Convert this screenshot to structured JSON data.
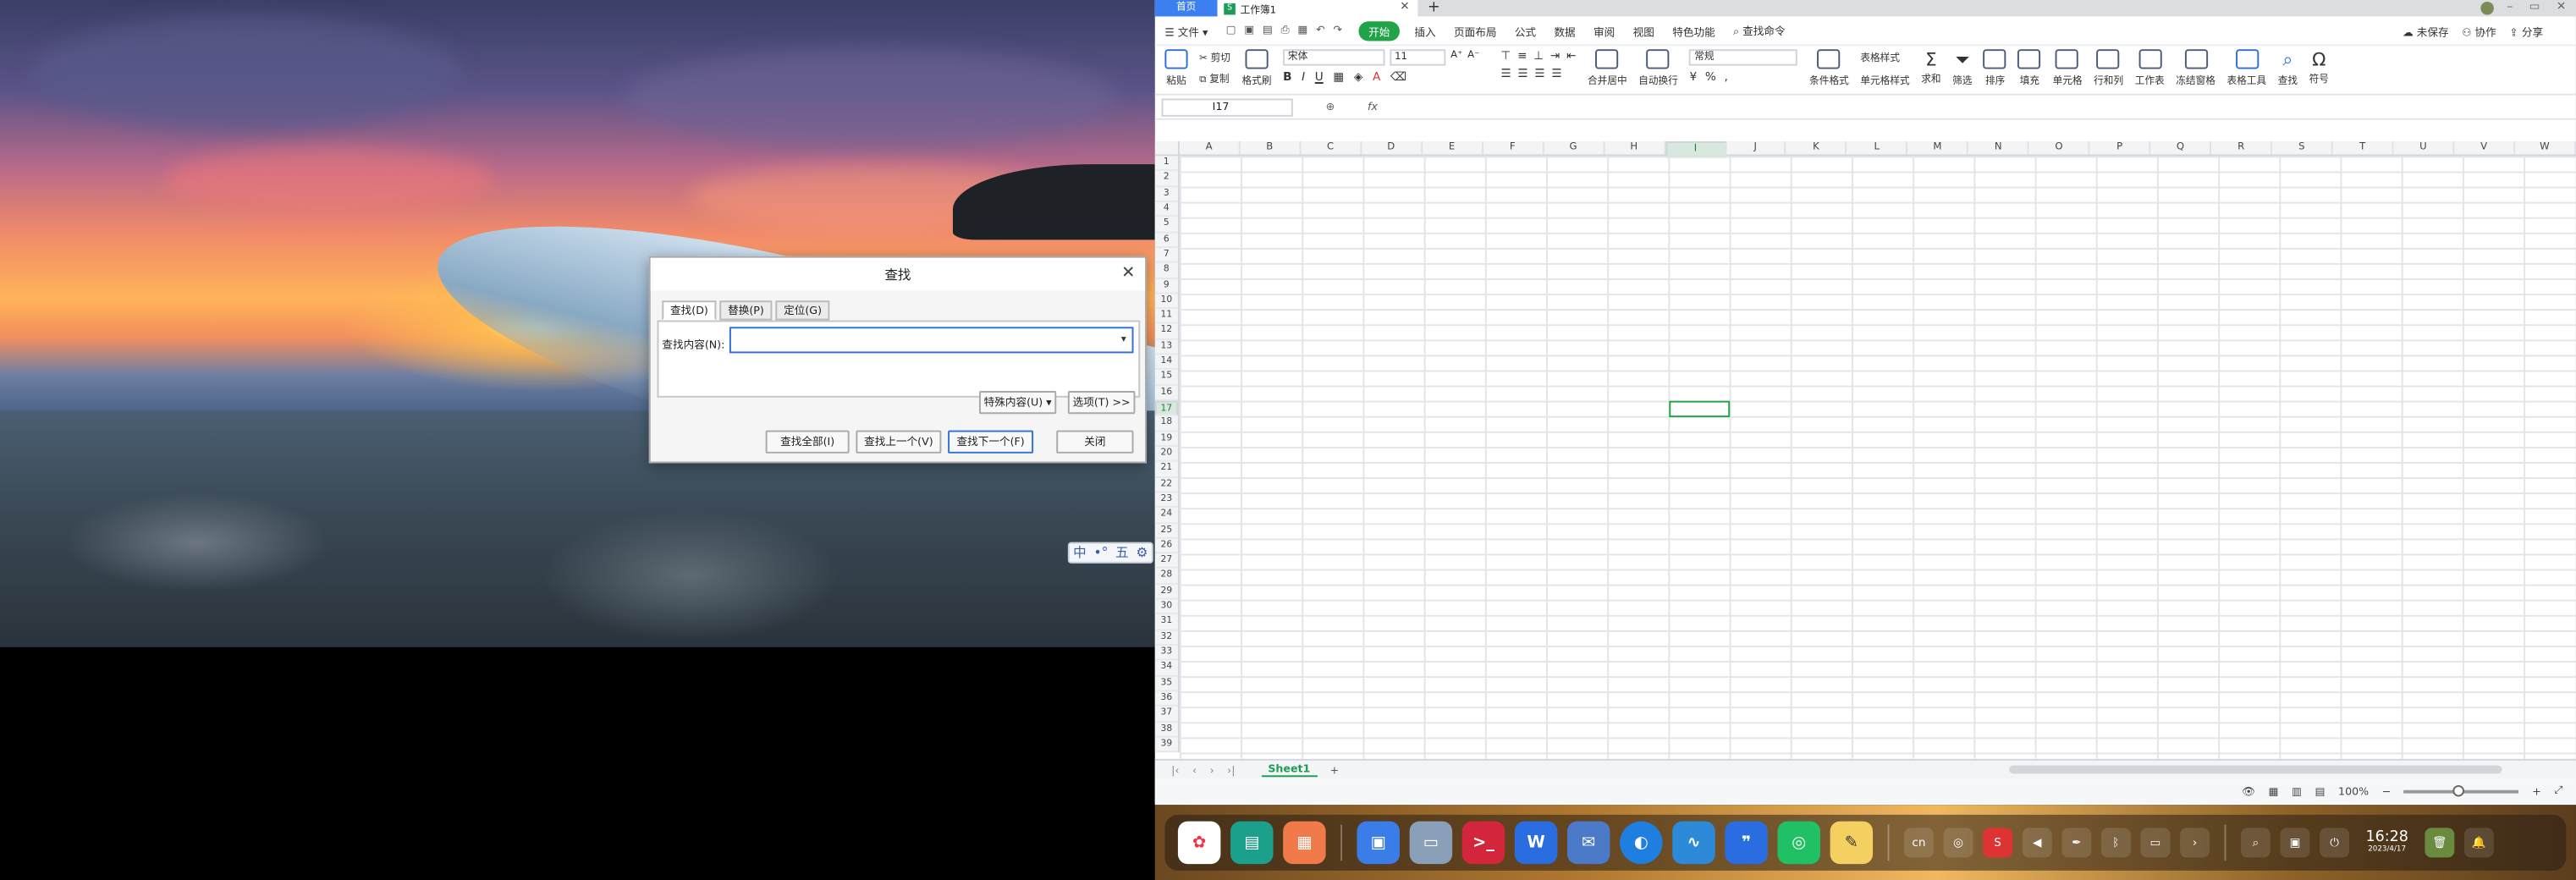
{
  "find_dialog": {
    "title": "查找",
    "tabs": [
      "查找(D)",
      "替换(P)",
      "定位(G)"
    ],
    "find_label": "查找内容(N):",
    "find_value": "",
    "special_button": "特殊内容(U)",
    "options_button": "选项(T) >>",
    "find_all": "查找全部(I)",
    "find_prev": "查找上一个(V)",
    "find_next": "查找下一个(F)",
    "close": "关闭"
  },
  "ime": {
    "labels": [
      "中",
      "•°",
      "五",
      "⚙"
    ]
  },
  "wps": {
    "tabs": {
      "home": "首页",
      "doc": "工作簿1",
      "doc_icon": "S"
    },
    "menu": {
      "file": "文件",
      "start": "开始",
      "items": [
        "插入",
        "页面布局",
        "公式",
        "数据",
        "审阅",
        "视图",
        "特色功能"
      ],
      "search": "查找命令",
      "unsaved": "未保存",
      "collab": "协作",
      "share": "分享"
    },
    "ribbon": {
      "paste": "粘贴",
      "cut": "剪切",
      "copy": "复制",
      "format_painter": "格式刷",
      "font": "宋体",
      "font_size": "11",
      "number_format": "常规",
      "merge": "合并居中",
      "wrap": "自动换行",
      "cond_format": "条件格式",
      "table_style": "表格样式",
      "cell_style": "单元格样式",
      "sum": "求和",
      "filter": "筛选",
      "sort": "排序",
      "fill": "填充",
      "cell": "单元格",
      "rowcol": "行和列",
      "sheet": "工作表",
      "freeze": "冻结窗格",
      "tools": "表格工具",
      "find": "查找",
      "symbol": "符号"
    },
    "namebox": "I17",
    "fx": "fx",
    "columns": [
      "A",
      "B",
      "C",
      "D",
      "E",
      "F",
      "G",
      "H",
      "I",
      "J",
      "K",
      "L",
      "M",
      "N",
      "O",
      "P",
      "Q",
      "R",
      "S",
      "T",
      "U",
      "V",
      "W"
    ],
    "rows": [
      "1",
      "2",
      "3",
      "4",
      "5",
      "6",
      "7",
      "8",
      "9",
      "10",
      "11",
      "12",
      "13",
      "14",
      "15",
      "16",
      "17",
      "18",
      "19",
      "20",
      "21",
      "22",
      "23",
      "24",
      "25",
      "26",
      "27",
      "28",
      "29",
      "30",
      "31",
      "32",
      "33",
      "34",
      "35",
      "36",
      "37",
      "38",
      "39"
    ],
    "selected_col": "I",
    "selected_row": "17",
    "sheet_tab": "Sheet1",
    "zoom": "100%"
  },
  "taskbar": {
    "time": "16:28",
    "date": "2023/4/17",
    "lang": "cn"
  }
}
